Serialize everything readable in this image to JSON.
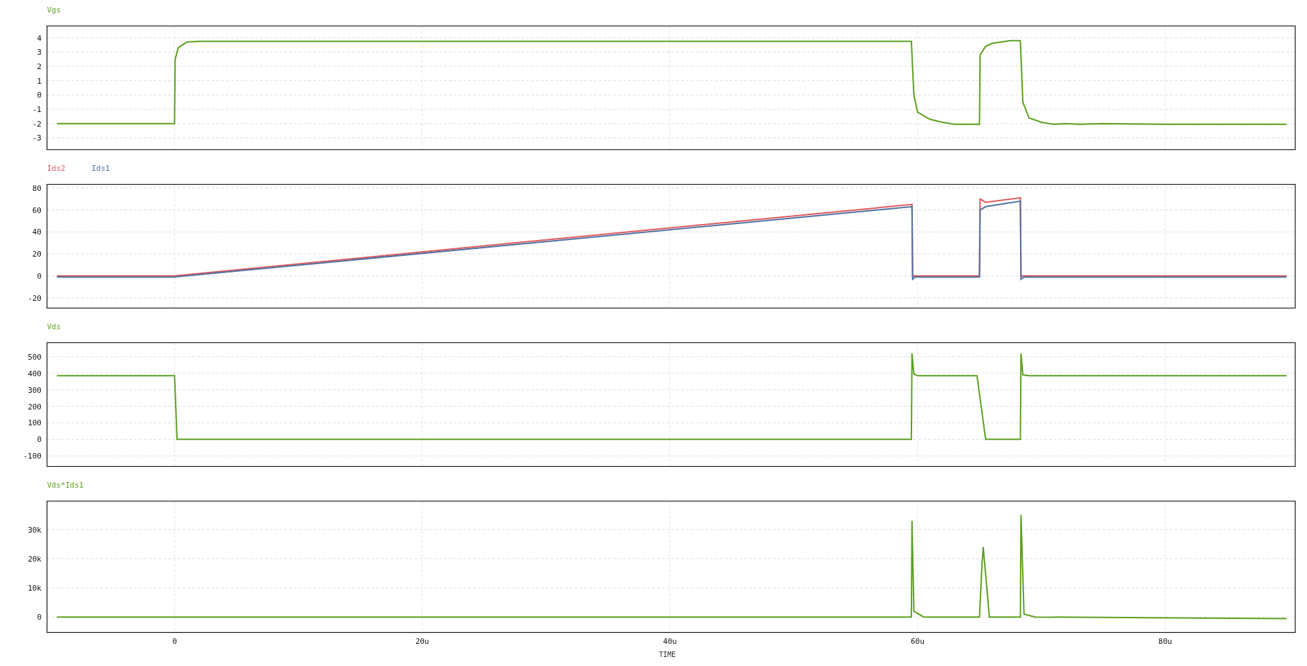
{
  "charts": [
    {
      "chart_data": {
        "type": "line",
        "grid": true,
        "xlim": [
          -10.3,
          90.5
        ],
        "ylim": [
          -3.8,
          4.8
        ],
        "yticks": [
          -3,
          -2,
          -1,
          0,
          1,
          2,
          3,
          4
        ],
        "x": [
          -9.5,
          0,
          0.05,
          0.3,
          1,
          2,
          59.5,
          59.7,
          60,
          61,
          62,
          63,
          65,
          65.05,
          65.5,
          66,
          67.5,
          68.3,
          68.5,
          69,
          70,
          71,
          72,
          73,
          75,
          80,
          89.8
        ],
        "series": [
          {
            "name": "Vgs",
            "color": "#5aa01e",
            "values": [
              -2,
              -2,
              2.5,
              3.3,
              3.7,
              3.75,
              3.75,
              0,
              -1.2,
              -1.7,
              -1.9,
              -2.05,
              -2.05,
              2.8,
              3.4,
              3.6,
              3.8,
              3.8,
              -0.5,
              -1.6,
              -1.9,
              -2.05,
              -2.0,
              -2.05,
              -2.0,
              -2.05,
              -2.05
            ]
          }
        ]
      }
    },
    {
      "chart_data": {
        "type": "line",
        "grid": true,
        "xlim": [
          -10.3,
          90.5
        ],
        "ylim": [
          -29,
          83
        ],
        "yticks": [
          -20,
          0,
          20,
          40,
          60,
          80
        ],
        "x": [
          -9.5,
          0,
          59.55,
          59.6,
          59.8,
          65,
          65.05,
          65.5,
          68.3,
          68.35,
          68.6,
          89.8
        ],
        "series": [
          {
            "name": "Ids2",
            "color": "#e0585a",
            "values": [
              0,
              0,
              65,
              0,
              0,
              0,
              70,
              67,
              71,
              0,
              0,
              0
            ]
          },
          {
            "name": "Ids1",
            "color": "#4f6fa3",
            "values": [
              -1,
              -1,
              63,
              -3,
              -1,
              -1,
              60,
              63,
              68,
              -3,
              -1,
              -1
            ]
          }
        ]
      }
    },
    {
      "chart_data": {
        "type": "line",
        "grid": true,
        "xlim": [
          -10.3,
          90.5
        ],
        "ylim": [
          -162,
          583
        ],
        "yticks": [
          -100,
          0,
          100,
          200,
          300,
          400,
          500
        ],
        "x": [
          -9.5,
          0,
          0.2,
          59.5,
          59.55,
          59.7,
          60,
          64.8,
          65.5,
          68.3,
          68.35,
          68.5,
          69,
          89.8
        ],
        "series": [
          {
            "name": "Vds",
            "color": "#5aa01e",
            "values": [
              385,
              385,
              0,
              0,
              520,
              395,
              385,
              385,
              0,
              0,
              520,
              390,
              385,
              385
            ]
          }
        ]
      }
    },
    {
      "chart_data": {
        "type": "line",
        "grid": true,
        "xlabel": "TIME",
        "xlim": [
          -10.3,
          90.5
        ],
        "ylim": [
          -5150,
          39600
        ],
        "yticks": [
          {
            "value": 0,
            "label": "0"
          },
          {
            "value": 10000,
            "label": "10k"
          },
          {
            "value": 20000,
            "label": "20k"
          },
          {
            "value": 30000,
            "label": "30k"
          }
        ],
        "xticks": [
          {
            "value": 0,
            "label": "0"
          },
          {
            "value": 20,
            "label": "20u"
          },
          {
            "value": 40,
            "label": "40u"
          },
          {
            "value": 60,
            "label": "60u"
          },
          {
            "value": 80,
            "label": "80u"
          }
        ],
        "x": [
          -9.5,
          59.5,
          59.55,
          59.7,
          60.5,
          65,
          65.2,
          65.3,
          65.8,
          68.3,
          68.35,
          68.6,
          69.5,
          89.8
        ],
        "series": [
          {
            "name": "Vds*Ids1",
            "color": "#5aa01e",
            "values": [
              0,
              0,
              33000,
              2000,
              0,
              0,
              18000,
              24000,
              0,
              0,
              35000,
              1000,
              0,
              -500
            ]
          }
        ]
      }
    }
  ]
}
